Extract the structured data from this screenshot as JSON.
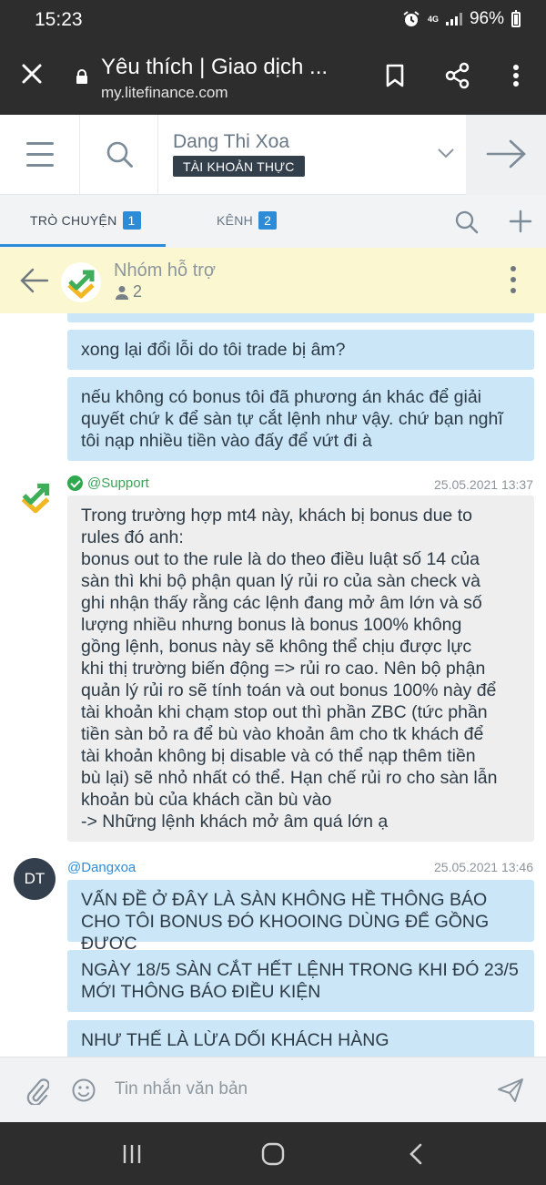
{
  "status_bar": {
    "time": "15:23",
    "network": "4G",
    "battery": "96%"
  },
  "browser": {
    "title": "Yêu thích | Giao dịch ...",
    "host": "my.litefinance.com",
    "icons": [
      "close-icon",
      "lock-icon",
      "bookmark-icon",
      "share-icon",
      "more-vertical-icon"
    ]
  },
  "header": {
    "account_name": "Dang Thi Xoa",
    "account_type": "TÀI KHOẢN THỰC",
    "icons": [
      "menu-icon",
      "search-icon",
      "chevron-down-icon",
      "arrow-right-icon"
    ]
  },
  "tabs": [
    {
      "label": "TRÒ CHUYỆN",
      "count": "1",
      "active": true
    },
    {
      "label": "KÊNH",
      "count": "2",
      "active": false
    }
  ],
  "group": {
    "name": "Nhóm hỗ trợ",
    "members": "2"
  },
  "messages": {
    "m1": "xong lại đổi lỗi do tôi trade bị âm?",
    "m2": "nếu không có bonus tôi đã phương án khác để giải quyết chứ k để sàn tự cắt lệnh như vậy. chứ bạn nghĩ tôi nạp nhiều tiền vào đấy để vứt đi à",
    "support": {
      "author": "@Support",
      "time": "25.05.2021 13:37",
      "lines": [
        "Trong trường hợp mt4 này, khách bị bonus due to",
        "rules đó anh:",
        "bonus out to the rule là do theo điều luật số 14 của",
        "sàn thì khi bộ phận quan lý rủi ro của sàn check và",
        "ghi nhận thấy rằng các lệnh đang mở âm lớn và số",
        "lượng nhiều nhưng bonus là bonus 100% không",
        "gồng lệnh, bonus này sẽ không thể chịu được lực",
        "khi thị trường biến động => rủi ro cao. Nên bộ phận",
        "quản lý rủi ro sẽ tính toán và out bonus 100% này để",
        "tài khoản khi chạm stop out thì phần ZBC (tức phần",
        "tiền sàn bỏ ra để bù vào khoản âm cho tk khách để",
        "tài khoản không bị disable và có thể nạp thêm tiền",
        "bù lại) sẽ nhỏ nhất có thể. Hạn chế rủi ro cho sàn lẫn",
        "khoản bù của khách cần bù vào",
        "-> Những lệnh khách mở âm quá lớn ạ"
      ]
    },
    "dangxoa": {
      "author": "@Dangxoa",
      "initials": "DT",
      "time": "25.05.2021 13:46",
      "m1": "VẤN ĐỀ Ở ĐÂY LÀ SÀN KHÔNG HỀ THÔNG BÁO CHO TÔI BONUS ĐÓ KHOOING DÙNG ĐỂ GỒNG ĐƯỢC",
      "m2": "NGÀY 18/5 SÀN CẮT HẾT LỆNH TRONG KHI ĐÓ 23/5 MỚI THÔNG BÁO ĐIỀU KIỆN",
      "m3": "NHƯ THẾ LÀ LỪA DỐI KHÁCH HÀNG"
    }
  },
  "composer": {
    "placeholder": "Tin nhắn văn bản",
    "icons": [
      "paperclip-icon",
      "emoji-icon",
      "send-icon"
    ]
  },
  "nav_bar": {
    "icons": [
      "recent-apps-icon",
      "home-icon",
      "back-icon"
    ]
  },
  "colors": {
    "accent": "#2d8cd8",
    "bubble_blue": "#cbe6f7",
    "bubble_grey": "#eeeeee",
    "group_bar": "#fbf7d1",
    "dark_bar": "#2d2d2d"
  }
}
